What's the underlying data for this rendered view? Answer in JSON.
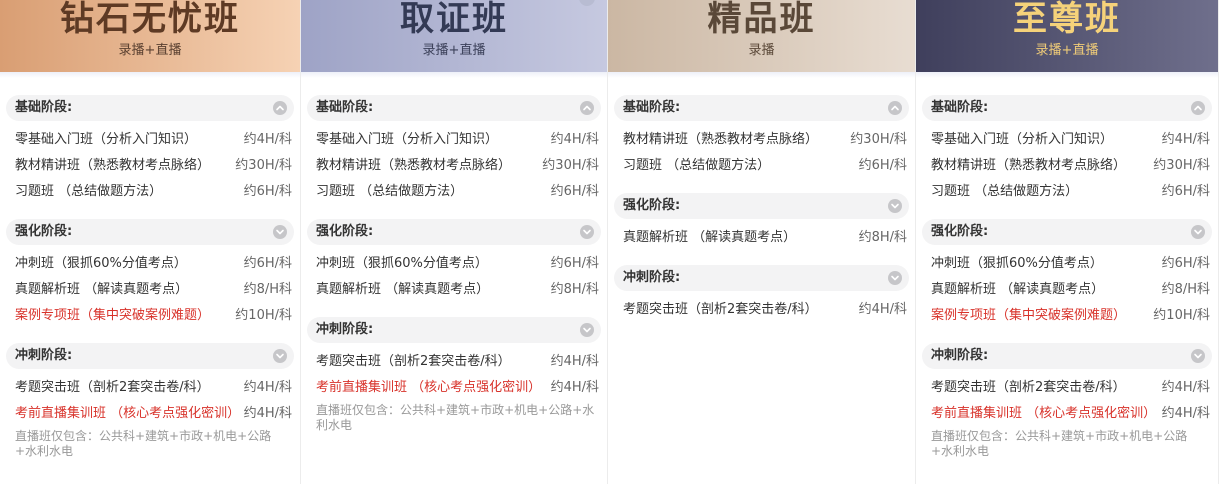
{
  "columns": [
    {
      "title": "钻石无忧班",
      "subtitle": "录播+直播",
      "header_colors": [
        "#d99e73",
        "#f6d2b4"
      ],
      "title_color": "#5e3a24",
      "subtitle_color": "#5a4030",
      "sections": [
        {
          "stage": "基础阶段:",
          "items": [
            {
              "name": "零基础入门班（分析入门知识）",
              "hours": "约4H/科"
            },
            {
              "name": "教材精讲班（熟悉教材考点脉络）",
              "hours": "约30H/科"
            },
            {
              "name": "习题班 （总结做题方法）",
              "hours": "约6H/科"
            }
          ]
        },
        {
          "stage": "强化阶段:",
          "items": [
            {
              "name": "冲刺班（狠抓60%分值考点）",
              "hours": "约6H/科"
            },
            {
              "name": "真题解析班 （解读真题考点）",
              "hours": "约8/H科"
            },
            {
              "name": "案例专项班（集中突破案例难题）",
              "hours": "约10H/科",
              "highlight": true
            }
          ]
        },
        {
          "stage": "冲刺阶段:",
          "items": [
            {
              "name": "考题突击班（剖析2套突击卷/科）",
              "hours": "约4H/科"
            },
            {
              "name": "考前直播集训班 （核心考点强化密训）",
              "hours": "约4H/科",
              "highlight": true
            }
          ],
          "note": "直播班仅包含：公共科+建筑+市政+机电+公路+水利水电"
        }
      ]
    },
    {
      "title": "取证班",
      "subtitle": "录播+直播",
      "header_colors": [
        "#9ea3c6",
        "#c6c9e0"
      ],
      "title_color": "#333a55",
      "subtitle_color": "#3a3f58",
      "sections": [
        {
          "stage": "基础阶段:",
          "items": [
            {
              "name": "零基础入门班（分析入门知识）",
              "hours": "约4H/科"
            },
            {
              "name": "教材精讲班（熟悉教材考点脉络）",
              "hours": "约30H/科"
            },
            {
              "name": "习题班 （总结做题方法）",
              "hours": "约6H/科"
            }
          ]
        },
        {
          "stage": "强化阶段:",
          "items": [
            {
              "name": "冲刺班（狠抓60%分值考点）",
              "hours": "约6H/科"
            },
            {
              "name": "真题解析班 （解读真题考点）",
              "hours": "约8H/科"
            }
          ]
        },
        {
          "stage": "冲刺阶段:",
          "items": [
            {
              "name": "考题突击班（剖析2套突击卷/科）",
              "hours": "约4H/科"
            },
            {
              "name": "考前直播集训班 （核心考点强化密训）",
              "hours": "约4H/科",
              "highlight": true
            }
          ],
          "note": "直播班仅包含：公共科+建筑+市政+机电+公路+水利水电"
        }
      ]
    },
    {
      "title": "精品班",
      "subtitle": "录播",
      "header_colors": [
        "#cbb7a3",
        "#e8ddd2"
      ],
      "title_color": "#5a4838",
      "subtitle_color": "#5a4838",
      "sections": [
        {
          "stage": "基础阶段:",
          "items": [
            {
              "name": "教材精讲班（熟悉教材考点脉络）",
              "hours": "约30H/科"
            },
            {
              "name": "习题班 （总结做题方法）",
              "hours": "约6H/科"
            }
          ]
        },
        {
          "stage": "强化阶段:",
          "items": [
            {
              "name": "真题解析班 （解读真题考点）",
              "hours": "约8H/科"
            }
          ]
        },
        {
          "stage": "冲刺阶段:",
          "items": [
            {
              "name": "考题突击班（剖析2套突击卷/科）",
              "hours": "约4H/科"
            }
          ]
        }
      ]
    },
    {
      "title": "至尊班",
      "subtitle": "录播+直播",
      "header_colors": [
        "#3f3f5c",
        "#6f6f8c"
      ],
      "title_color": "#f5d27a",
      "subtitle_color": "#f0cc78",
      "sections": [
        {
          "stage": "基础阶段:",
          "items": [
            {
              "name": "零基础入门班（分析入门知识）",
              "hours": "约4H/科"
            },
            {
              "name": "教材精讲班（熟悉教材考点脉络）",
              "hours": "约30H/科"
            },
            {
              "name": "习题班 （总结做题方法）",
              "hours": "约6H/科"
            }
          ]
        },
        {
          "stage": "强化阶段:",
          "items": [
            {
              "name": "冲刺班（狠抓60%分值考点）",
              "hours": "约6H/科"
            },
            {
              "name": "真题解析班 （解读真题考点）",
              "hours": "约8/H科"
            },
            {
              "name": "案例专项班（集中突破案例难题）",
              "hours": "约10H/科",
              "highlight": true
            }
          ]
        },
        {
          "stage": "冲刺阶段:",
          "items": [
            {
              "name": "考题突击班（剖析2套突击卷/科）",
              "hours": "约4H/科"
            },
            {
              "name": "考前直播集训班 （核心考点强化密训）",
              "hours": "约4H/科",
              "highlight": true
            }
          ],
          "note": "直播班仅包含：公共科+建筑+市政+机电+公路+水利水电"
        }
      ]
    }
  ],
  "icons": {
    "stage_toggle": "chevron-down-icon",
    "stage_toggle_open": "chevron-up-icon"
  },
  "colors": {
    "highlight_text": "#d8322a",
    "stage_bg": "#f3f3f4",
    "toggle_bg": "#c6c6c9"
  }
}
